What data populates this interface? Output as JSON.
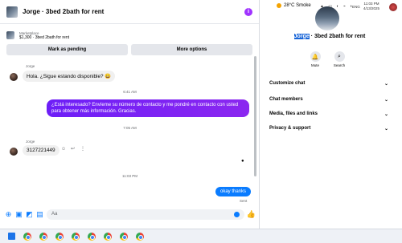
{
  "chat": {
    "title": "Jorge · 3bed 2bath for rent",
    "info_icon": "i",
    "marketplace_kicker": "Marketplace",
    "marketplace_desc": "$1,300 · 3bed 2bath for rent",
    "mark_pending_label": "Mark as pending",
    "more_options_label": "More options"
  },
  "messages": {
    "sender_1": "Jorge",
    "msg_1": "Hola. ¿Sigue estando disponible? 😀",
    "time_1": "6:41 AM",
    "msg_2": "¿Está interesado? Envíeme su número de contacto y me pondré en contacto con usted para obtener más información. Gracias.",
    "time_2": "7:05 AM",
    "sender_2": "Jorge",
    "msg_3": "3127221449",
    "time_3": "11:03 PM",
    "msg_4": "okay thanks",
    "seen": "Sent"
  },
  "composer": {
    "placeholder": "Aa"
  },
  "side": {
    "name_highlight": "Jorge",
    "name_rest": " · 3bed 2bath for rent",
    "mute_label": "Mute",
    "search_label": "Search",
    "rows": [
      "Customize chat",
      "Chat members",
      "Media, files and links",
      "Privacy & support"
    ]
  },
  "taskbar": {
    "weather": "28°C  Smoke",
    "lang": "ENG",
    "time": "11:03 PM",
    "date": "4/13/2025"
  },
  "colors": {
    "accent_purple": "#7f1cff",
    "messenger_blue": "#0a7cff",
    "bg": "#f0f2f5"
  }
}
